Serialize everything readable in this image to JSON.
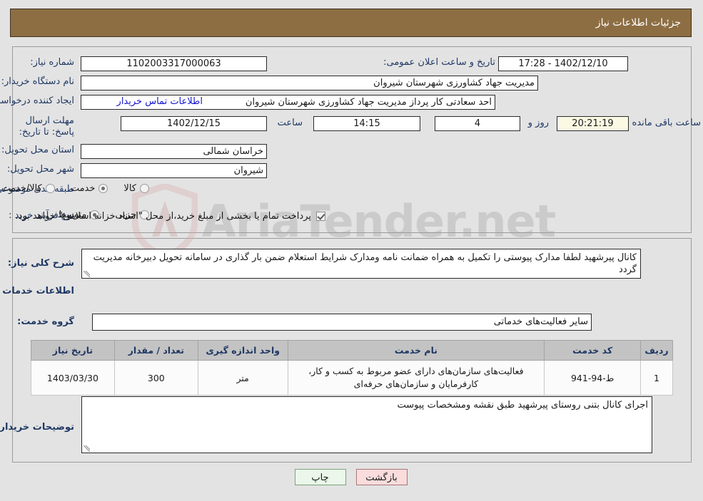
{
  "header": {
    "title": "جزئیات اطلاعات نیاز"
  },
  "form": {
    "need_number_label": "شماره نیاز:",
    "need_number_value": "1102003317000063",
    "public_announce_label": "تاریخ و ساعت اعلان عمومی:",
    "public_announce_value": "1402/12/10 - 17:28",
    "buyer_org_label": "نام دستگاه خریدار:",
    "buyer_org_value": "مدیریت جهاد کشاورزی شهرستان شیروان",
    "creator_label": "ایجاد کننده درخواست:",
    "creator_value": "احد سعادتی کار پرداز مدیریت جهاد کشاورزی شهرستان شیروان",
    "contact_link": "اطلاعات تماس خریدار",
    "deadline_label": "مهلت ارسال پاسخ: تا تاریخ:",
    "deadline_date": "1402/12/15",
    "hour_label": "ساعت",
    "deadline_time": "14:15",
    "days_value": "4",
    "days_label": "روز و",
    "countdown_value": "20:21:19",
    "countdown_label": "ساعت باقی مانده",
    "province_label": "استان محل تحویل:",
    "province_value": "خراسان شمالی",
    "city_label": "شهر محل تحویل:",
    "city_value": "شیروان",
    "category_label": "طبقه بندی موضوعی:",
    "category_options": [
      {
        "label": "کالا",
        "selected": false
      },
      {
        "label": "خدمت",
        "selected": true
      },
      {
        "label": "کالا/خدمت",
        "selected": false
      }
    ],
    "process_label": "نوع فرآیند خرید :",
    "process_options": [
      {
        "label": "جزیی",
        "selected": false
      },
      {
        "label": "متوسط",
        "selected": true
      }
    ],
    "treasury_checkbox_checked": true,
    "treasury_note": "پرداخت تمام یا بخشی از مبلغ خرید،از محل \"اسناد خزانه اسلامی\" خواهد بود."
  },
  "details": {
    "general_desc_label": "شرح کلی نیاز:",
    "general_desc_value": "کانال پیرشهید لطفا مدارک پیوستی را تکمیل به همراه ضمانت نامه ومدارک شرایط استعلام ضمن بار گذاری در سامانه تحویل دبیرخانه مدیریت گردد",
    "services_section_title": "اطلاعات خدمات مورد نیاز",
    "service_group_label": "گروه خدمت:",
    "service_group_value": "سایر فعالیت‌های خدماتی",
    "buyer_notes_label": "توضیحات خریدار:",
    "buyer_notes_value": "اجرای کانال بتنی روستای پیرشهید طبق نقشه ومشخصات پیوست"
  },
  "table": {
    "headers": [
      "ردیف",
      "کد خدمت",
      "نام خدمت",
      "واحد اندازه گیری",
      "تعداد / مقدار",
      "تاریخ نیاز"
    ],
    "rows": [
      {
        "row_no": "1",
        "service_code": "ط-94-941",
        "service_name": "فعالیت‌های سازمان‌های دارای عضو مربوط به کسب و کار، کارفرمایان و سازمان‌های حرفه‌ای",
        "unit": "متر",
        "quantity": "300",
        "need_date": "1403/03/30"
      }
    ]
  },
  "footer": {
    "print_label": "چاپ",
    "back_label": "بازگشت"
  },
  "watermark": {
    "text": "AriaTender.net"
  },
  "colors": {
    "header_bg": "#8d6e43",
    "page_bg": "#e3e3e3",
    "label_text": "#1f3864",
    "link": "#1414cd",
    "table_header_bg": "#c3c3c3",
    "countdown_bg": "#fbf8e3",
    "print_btn_bg": "#eaf7ea",
    "back_btn_bg": "#fbdcdc"
  }
}
